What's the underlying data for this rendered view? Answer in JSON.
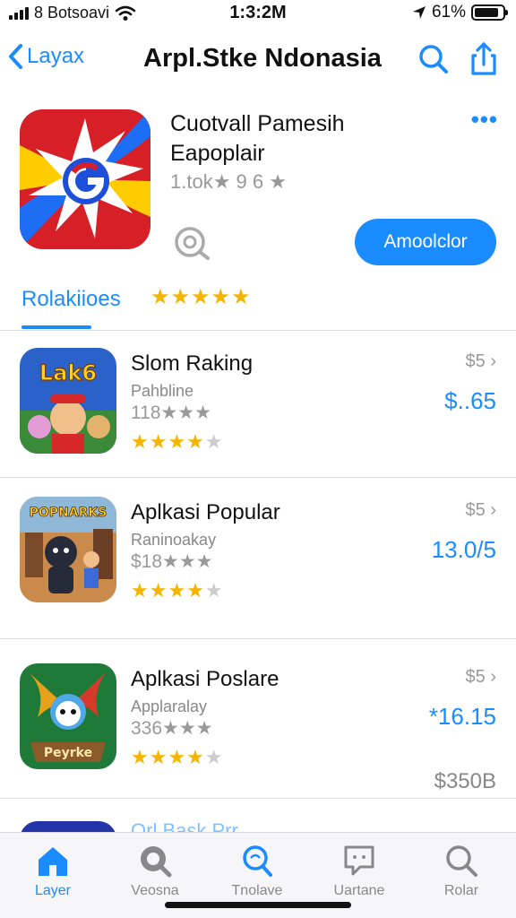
{
  "status": {
    "carrier": "8 Botsoavi",
    "time": "1:3:2M",
    "battery": "61%",
    "battery_level": 0.85
  },
  "nav": {
    "back_label": "Layax",
    "title": "Arpl.Stke Ndonasia",
    "search_icon": "search-icon",
    "share_icon": "share-icon"
  },
  "hero": {
    "title": "Cuotvall Pamesih Eapoplair",
    "rating_text": "1.tok★ 9 6 ★",
    "get_label": "Amoolclor",
    "more_label": "•••",
    "tab_label": "Rolakiioes",
    "tab_stars": "★★★★★"
  },
  "apps": [
    {
      "name": "Slom Raking",
      "subtitle": "Pahbline",
      "count": "118★★★",
      "stars": "★★★★",
      "half_star": "★",
      "meta": "$5 ›",
      "price": "$..65",
      "price2": "",
      "thumb_text": "Lak6"
    },
    {
      "name": "Aplkasi Popular",
      "subtitle": "Raninoakay",
      "count": "$18★★★",
      "stars": "★★★★",
      "half_star": "★",
      "meta": "$5 ›",
      "price": "13.0/5",
      "price2": "",
      "thumb_text": "POPNARKS"
    },
    {
      "name": "Aplkasi Poslare",
      "subtitle": "Applaralay",
      "count": "336★★★",
      "stars": "★★★★",
      "half_star": "★",
      "meta": "$5 ›",
      "price": "*16.15",
      "price2": "$350B",
      "thumb_text": "Peyrke"
    }
  ],
  "peek_text": "Orl Bask Prr",
  "tabbar": [
    {
      "label": "Layer",
      "icon": "home-icon",
      "active": true
    },
    {
      "label": "Veosna",
      "icon": "search-circle-icon",
      "active": false
    },
    {
      "label": "Tnolave",
      "icon": "magnifier-icon",
      "active": false
    },
    {
      "label": "Uartane",
      "icon": "chat-icon",
      "active": false
    },
    {
      "label": "Rolar",
      "icon": "search-icon",
      "active": false
    }
  ],
  "colors": {
    "accent": "#1a8cff",
    "star": "#f5b400",
    "muted": "#999999"
  }
}
